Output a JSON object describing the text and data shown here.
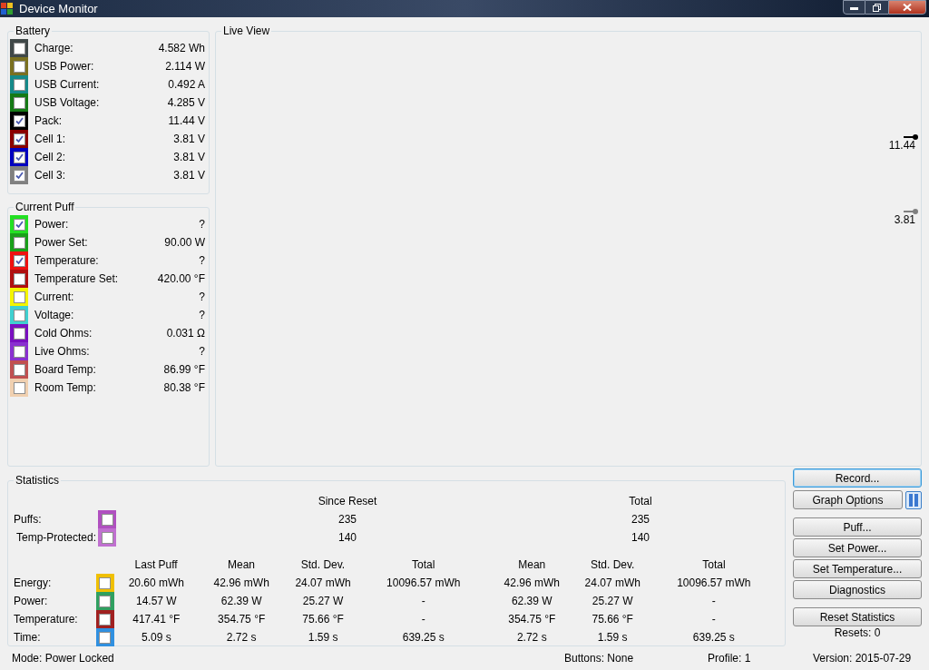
{
  "window": {
    "title": "Device Monitor"
  },
  "battery": {
    "title": "Battery",
    "rows": [
      {
        "label": "Charge:",
        "value": "4.582 Wh",
        "color": "#404848",
        "checked": false
      },
      {
        "label": "USB Power:",
        "value": "2.114 W",
        "color": "#7a7020",
        "checked": false
      },
      {
        "label": "USB Current:",
        "value": "0.492 A",
        "color": "#168a8a",
        "checked": false
      },
      {
        "label": "USB Voltage:",
        "value": "4.285 V",
        "color": "#157a15",
        "checked": false
      },
      {
        "label": "Pack:",
        "value": "11.44 V",
        "color": "#000000",
        "checked": true
      },
      {
        "label": "Cell 1:",
        "value": "3.81 V",
        "color": "#8b0000",
        "checked": true
      },
      {
        "label": "Cell 2:",
        "value": "3.81 V",
        "color": "#0000c0",
        "checked": true
      },
      {
        "label": "Cell 3:",
        "value": "3.81 V",
        "color": "#808080",
        "checked": true
      }
    ]
  },
  "current_puff": {
    "title": "Current Puff",
    "rows": [
      {
        "label": "Power:",
        "value": "?",
        "color": "#22e022",
        "checked": true
      },
      {
        "label": "Power Set:",
        "value": "90.00 W",
        "color": "#1aa01a",
        "checked": false
      },
      {
        "label": "Temperature:",
        "value": "?",
        "color": "#ee1111",
        "checked": true
      },
      {
        "label": "Temperature Set:",
        "value": "420.00 °F",
        "color": "#b01010",
        "checked": false
      },
      {
        "label": "Current:",
        "value": "?",
        "color": "#f4f400",
        "checked": false
      },
      {
        "label": "Voltage:",
        "value": "?",
        "color": "#40d0d0",
        "checked": false
      },
      {
        "label": "Cold Ohms:",
        "value": "0.031 Ω",
        "color": "#7a10c0",
        "checked": false
      },
      {
        "label": "Live Ohms:",
        "value": "?",
        "color": "#8a30d0",
        "checked": false
      },
      {
        "label": "Board Temp:",
        "value": "86.99 °F",
        "color": "#c05050",
        "checked": false
      },
      {
        "label": "Room Temp:",
        "value": "80.38 °F",
        "color": "#f0d0b0",
        "checked": false
      }
    ]
  },
  "live_view": {
    "title": "Live View",
    "markers": [
      {
        "value": "11.44",
        "color": "#000000"
      },
      {
        "value": "3.81",
        "color": "#808080"
      }
    ]
  },
  "statistics": {
    "title": "Statistics",
    "since_reset_header": "Since Reset",
    "total_header": "Total",
    "counts": [
      {
        "label": "Puffs:",
        "color": "#b050c0",
        "checked": false,
        "since_reset": "235",
        "total": "235"
      },
      {
        "label": "Temp-Protected:",
        "color": "#c070d0",
        "checked": false,
        "since_reset": "140",
        "total": "140"
      }
    ],
    "columns": [
      "Last Puff",
      "Mean",
      "Std. Dev.",
      "Total",
      "Mean",
      "Std. Dev.",
      "Total"
    ],
    "rows": [
      {
        "label": "Energy:",
        "color": "#f0c000",
        "checked": false,
        "values": [
          "20.60 mWh",
          "42.96 mWh",
          "24.07 mWh",
          "10096.57 mWh",
          "42.96 mWh",
          "24.07 mWh",
          "10096.57 mWh"
        ]
      },
      {
        "label": "Power:",
        "color": "#30a060",
        "checked": false,
        "values": [
          "14.57 W",
          "62.39 W",
          "25.27 W",
          "-",
          "62.39 W",
          "25.27 W",
          "-"
        ]
      },
      {
        "label": "Temperature:",
        "color": "#a02020",
        "checked": false,
        "values": [
          "417.41 °F",
          "354.75 °F",
          "75.66 °F",
          "-",
          "354.75 °F",
          "75.66 °F",
          "-"
        ]
      },
      {
        "label": "Time:",
        "color": "#3090e0",
        "checked": false,
        "values": [
          "5.09 s",
          "2.72 s",
          "1.59 s",
          "639.25 s",
          "2.72 s",
          "1.59 s",
          "639.25 s"
        ]
      }
    ]
  },
  "buttons": {
    "record": "Record...",
    "graph_options": "Graph Options",
    "paused": true,
    "actions": [
      "Puff...",
      "Set Power...",
      "Set Temperature...",
      "Diagnostics"
    ],
    "reset": "Reset Statistics",
    "resets": "Resets: 0"
  },
  "status_bar": {
    "mode": "Mode: Power Locked",
    "buttons": "Buttons: None",
    "profile": "Profile: 1",
    "version": "Version: 2015-07-29"
  }
}
